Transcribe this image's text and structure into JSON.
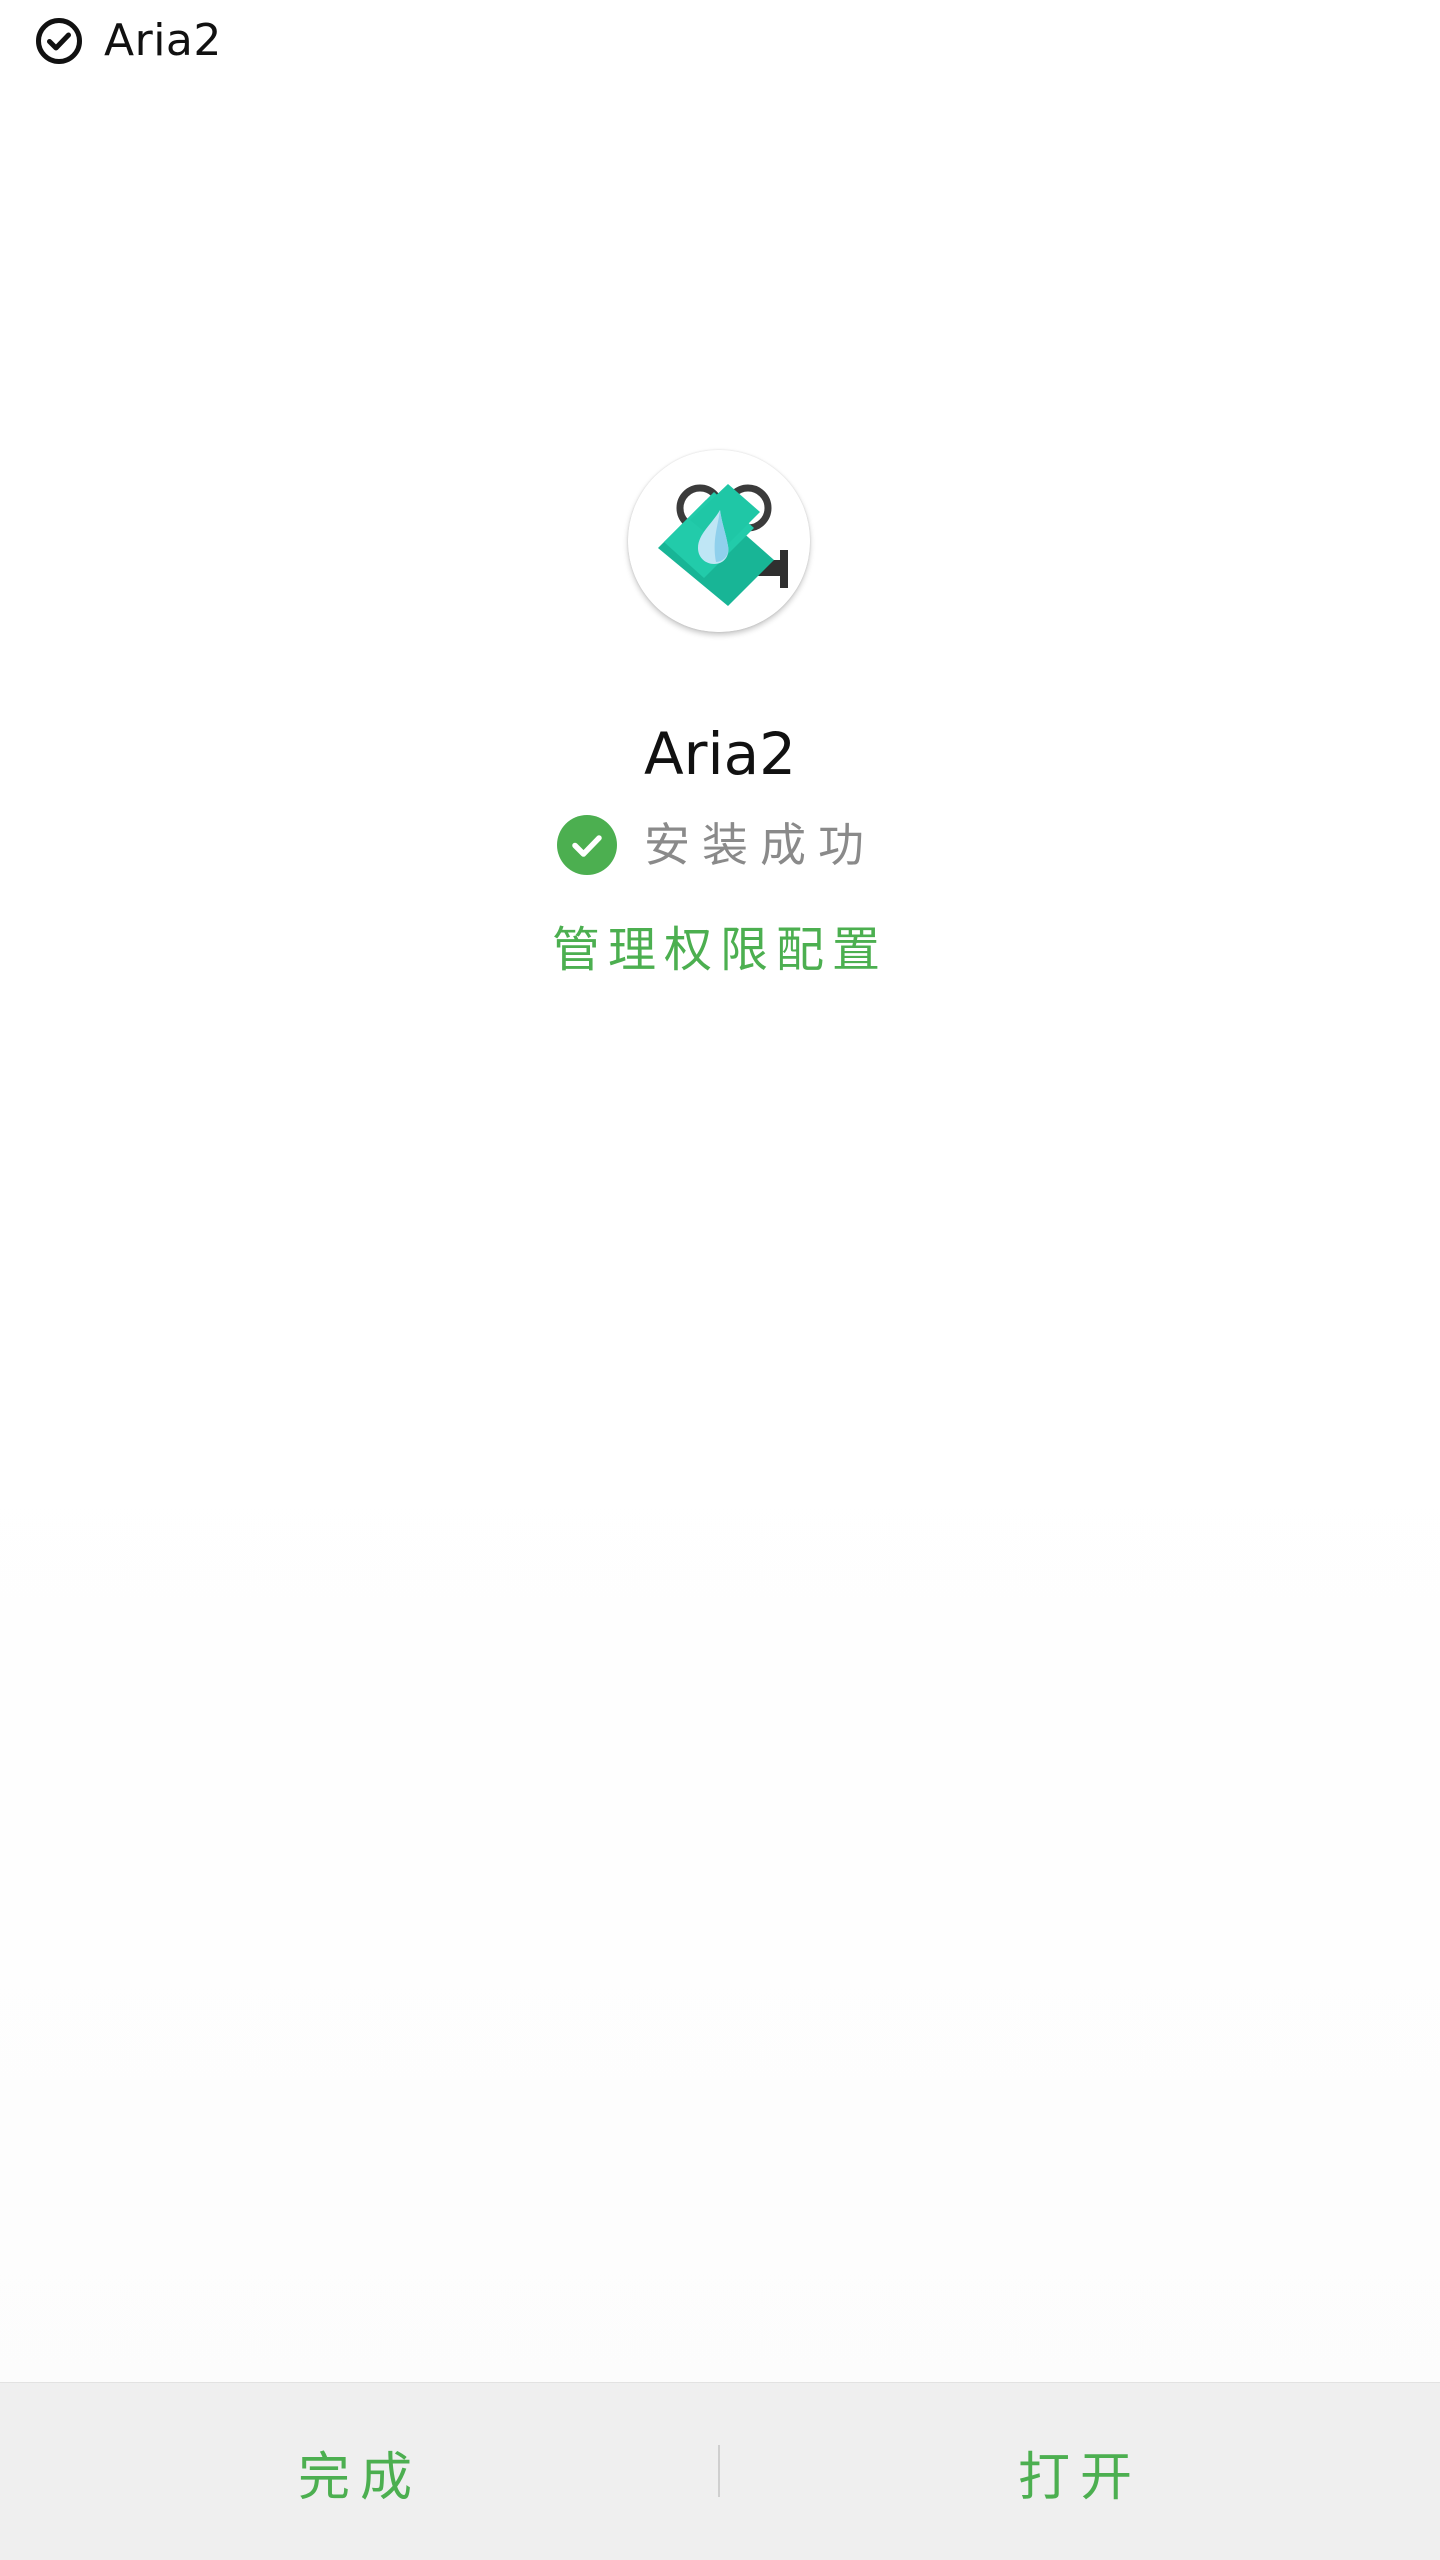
{
  "header": {
    "icon": "check-circle-icon",
    "title": "Aria2"
  },
  "app": {
    "icon": "aria2-app-icon",
    "name": "Aria2"
  },
  "status": {
    "icon": "check-circle-filled-icon",
    "text": "安装成功",
    "color": "#4CAF50"
  },
  "links": {
    "manage_permissions": "管理权限配置"
  },
  "actions": {
    "done_label": "完成",
    "open_label": "打开"
  },
  "colors": {
    "accent": "#4CAF50",
    "app_icon_teal": "#1DBF9F",
    "bottom_bar_bg": "#EFEFEF",
    "secondary_text": "#8A8A8A"
  }
}
